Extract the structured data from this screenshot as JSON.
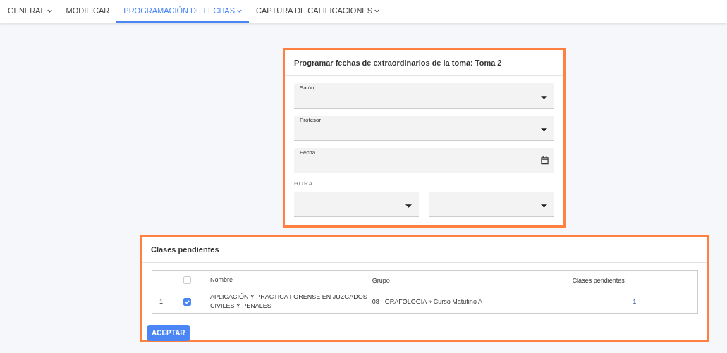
{
  "nav": {
    "tabs": [
      {
        "label": "GENERAL",
        "dropdown": true,
        "selected": false
      },
      {
        "label": "MODIFICAR",
        "dropdown": false,
        "selected": false
      },
      {
        "label": "PROGRAMACIÓN DE FECHAS",
        "dropdown": true,
        "selected": true
      },
      {
        "label": "CAPTURA DE CALIFICACIONES",
        "dropdown": true,
        "selected": false
      }
    ]
  },
  "schedule_card": {
    "title": "Programar fechas de extraordinarios de la toma: Toma 2",
    "fields": [
      {
        "label": "Salón",
        "kind": "select"
      },
      {
        "label": "Profesor",
        "kind": "select"
      },
      {
        "label": "Fecha",
        "kind": "date"
      }
    ],
    "time_label": "HORA",
    "time_fields": [
      {
        "kind": "select"
      },
      {
        "kind": "select"
      }
    ]
  },
  "pending_card": {
    "title": "Clases pendientes",
    "table": {
      "select_all_checked": false,
      "columns": [
        "Nombre",
        "Grupo",
        "Clases pendientes"
      ],
      "rows": [
        {
          "index": "1",
          "checked": true,
          "name": "APLICACIÓN Y PRACTICA FORENSE EN JUZGADOS CIVILES Y PENALES",
          "group": "08 - GRAFOLOGIA » Curso Matutino A",
          "pending": "1"
        }
      ]
    },
    "button": "ACEPTAR"
  }
}
